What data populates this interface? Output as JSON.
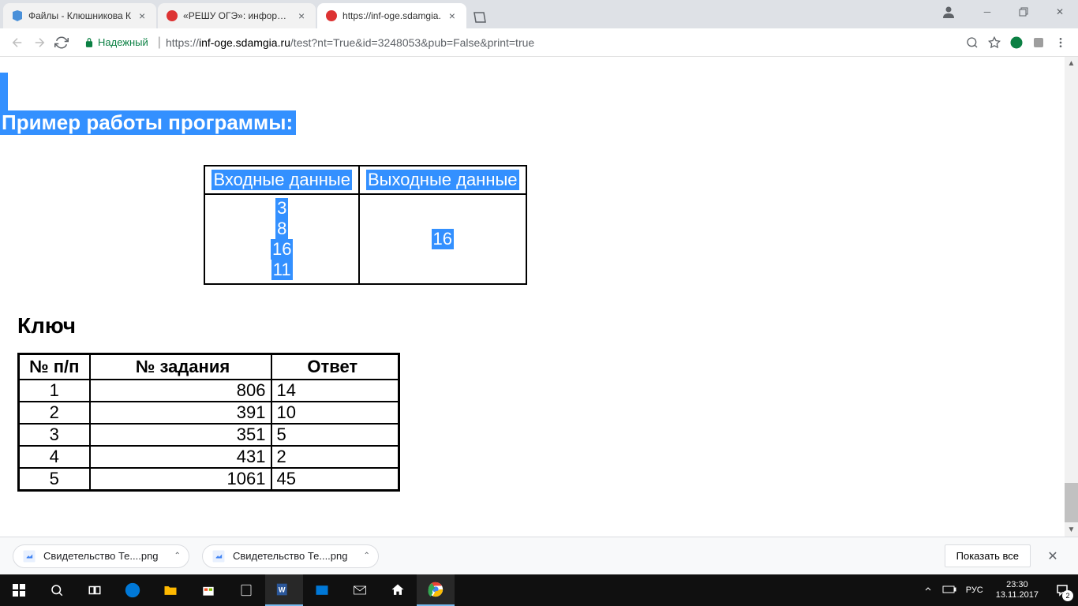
{
  "tabs": [
    {
      "title": "Файлы - Клюшникова К",
      "favicon": "blue"
    },
    {
      "title": "«РЕШУ ОГЭ»: информат",
      "favicon": "red"
    },
    {
      "title": "https://inf-oge.sdamgia.",
      "favicon": "red",
      "active": true
    }
  ],
  "address_bar": {
    "secure_label": "Надежный",
    "url_proto": "https://",
    "url_host": "inf-oge.sdamgia.ru",
    "url_path": "/test?nt=True&id=3248053&pub=False&print=true"
  },
  "page": {
    "example_heading": "Пример работы программы:",
    "example_table": {
      "header_in": "Входные данные",
      "header_out": "Выходные данные",
      "inputs": [
        "3",
        "8",
        "16",
        "11"
      ],
      "output": "16"
    },
    "key_heading": "Ключ",
    "key_table": {
      "headers": [
        "№ п/п",
        "№ задания",
        "Ответ"
      ],
      "rows": [
        {
          "n": "1",
          "task": "806",
          "ans": "14"
        },
        {
          "n": "2",
          "task": "391",
          "ans": "10"
        },
        {
          "n": "3",
          "task": "351",
          "ans": "5"
        },
        {
          "n": "4",
          "task": "431",
          "ans": "2"
        },
        {
          "n": "5",
          "task": "1061",
          "ans": "45"
        }
      ]
    }
  },
  "downloads": {
    "items": [
      {
        "name": "Свидетельство Те....png"
      },
      {
        "name": "Свидетельство Те....png"
      }
    ],
    "show_all": "Показать все"
  },
  "tray": {
    "lang": "РУС",
    "time": "23:30",
    "date": "13.11.2017",
    "notif_count": "2"
  }
}
